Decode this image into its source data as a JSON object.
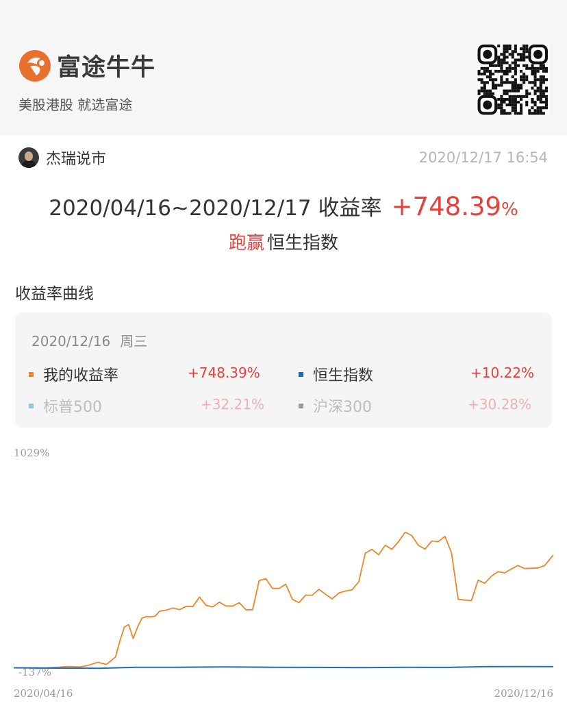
{
  "header": {
    "app_name": "富途牛牛",
    "slogan": "美股港股 就选富途",
    "logo_icon": "futu-logo-icon",
    "qr_icon": "qr-code-icon"
  },
  "post": {
    "author": "杰瑞说市",
    "time": "2020/12/17 16:54"
  },
  "summary": {
    "range": "2020/04/16~2020/12/17 收益率",
    "return_value": "+748.39",
    "return_unit": "%",
    "beat_text": "跑赢",
    "benchmark": "恒生指数"
  },
  "section": {
    "title": "收益率曲线"
  },
  "legend": {
    "date": "2020/12/16",
    "weekday": "周三",
    "items": [
      {
        "name": "我的收益率",
        "value": "+748.39%",
        "color": "#e8882a"
      },
      {
        "name": "恒生指数",
        "value": "+10.22%",
        "color": "#1f6cb0"
      },
      {
        "name": "标普500",
        "value": "+32.21%",
        "color": "#8fc8ea"
      },
      {
        "name": "沪深300",
        "value": "+30.28%",
        "color": "#9a9a9a"
      }
    ]
  },
  "colors": {
    "positive": "#e5413c",
    "muted_positive": "#f2aeb0",
    "muted_text": "#bdbdbd"
  },
  "chart_data": {
    "type": "line",
    "y_max_label": "1029%",
    "y_min_label": "-137%",
    "x_start_label": "2020/04/16",
    "x_end_label": "2020/12/16",
    "ylim": [
      -137,
      1029
    ],
    "xlim": [
      "2020/04/16",
      "2020/12/16"
    ],
    "grid": false,
    "series": [
      {
        "name": "我的收益率",
        "color": "#e8882a",
        "x": [
          "2020/04/16",
          "2020/04/21",
          "2020/04/26",
          "2020/05/01",
          "2020/05/06",
          "2020/05/11",
          "2020/05/16",
          "2020/05/20",
          "2020/05/24",
          "2020/05/28",
          "2020/06/01",
          "2020/06/03",
          "2020/06/05",
          "2020/06/07",
          "2020/06/09",
          "2020/06/11",
          "2020/06/13",
          "2020/06/15",
          "2020/06/17",
          "2020/06/19",
          "2020/06/21",
          "2020/06/24",
          "2020/06/27",
          "2020/06/30",
          "2020/07/03",
          "2020/07/06",
          "2020/07/09",
          "2020/07/12",
          "2020/07/15",
          "2020/07/18",
          "2020/07/21",
          "2020/07/24",
          "2020/07/27",
          "2020/07/30",
          "2020/08/02",
          "2020/08/05",
          "2020/08/08",
          "2020/08/11",
          "2020/08/14",
          "2020/08/17",
          "2020/08/20",
          "2020/08/23",
          "2020/08/26",
          "2020/08/29",
          "2020/09/01",
          "2020/09/04",
          "2020/09/07",
          "2020/09/10",
          "2020/09/13",
          "2020/09/16",
          "2020/09/19",
          "2020/09/22",
          "2020/09/25",
          "2020/09/28",
          "2020/10/01",
          "2020/10/04",
          "2020/10/07",
          "2020/10/10",
          "2020/10/13",
          "2020/10/16",
          "2020/10/19",
          "2020/10/22",
          "2020/10/25",
          "2020/10/28",
          "2020/10/31",
          "2020/11/03",
          "2020/11/06",
          "2020/11/09",
          "2020/11/12",
          "2020/11/15",
          "2020/11/18",
          "2020/11/21",
          "2020/11/24",
          "2020/11/27",
          "2020/11/30",
          "2020/12/03",
          "2020/12/06",
          "2020/12/09",
          "2020/12/12",
          "2020/12/16"
        ],
        "values": [
          -131,
          -131,
          -132,
          -131,
          -128,
          -124,
          -127,
          -116,
          -100,
          -112,
          -70,
          20,
          100,
          114,
          35,
          100,
          150,
          160,
          158,
          162,
          190,
          196,
          208,
          199,
          217,
          216,
          270,
          223,
          214,
          241,
          219,
          219,
          238,
          198,
          198,
          364,
          374,
          319,
          319,
          343,
          258,
          238,
          281,
          281,
          314,
          286,
          260,
          293,
          304,
          311,
          356,
          519,
          541,
          510,
          564,
          541,
          584,
          638,
          619,
          563,
          542,
          588,
          585,
          614,
          520,
          257,
          253,
          250,
          366,
          348,
          389,
          414,
          407,
          429,
          449,
          432,
          433,
          435,
          448,
          508
        ]
      },
      {
        "name": "恒生指数",
        "color": "#1f6cb0",
        "x": [
          "2020/04/16",
          "2020/05/05",
          "2020/05/25",
          "2020/06/10",
          "2020/06/30",
          "2020/07/20",
          "2020/08/10",
          "2020/09/01",
          "2020/09/20",
          "2020/10/10",
          "2020/10/30",
          "2020/11/15",
          "2020/12/01",
          "2020/12/16"
        ],
        "values": [
          -131,
          -133,
          -134,
          -128,
          -128,
          -126,
          -128,
          -129,
          -130,
          -128,
          -129,
          -125,
          -124,
          -125
        ]
      }
    ]
  }
}
